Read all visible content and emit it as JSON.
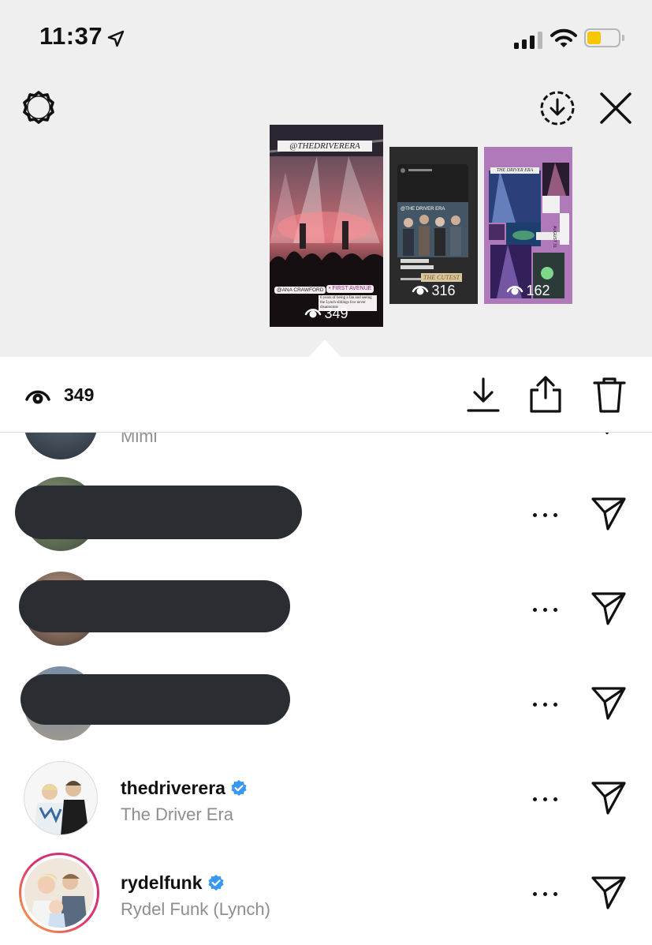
{
  "status_bar": {
    "time": "11:37",
    "battery_level": 0.45,
    "battery_color": "#f7c600"
  },
  "header": {
    "settings_icon": "gear-icon",
    "save_icon": "download-circle-icon",
    "close_icon": "close-icon"
  },
  "stories": [
    {
      "views": "349",
      "selected": true,
      "handle": "@THEDRIVERERA",
      "tags": [
        "@ANA CRAWFORD",
        "• FIRST AVENUE"
      ],
      "caption": "6 years of being a fan and seeing the Lynch siblings live never disappoints"
    },
    {
      "views": "316",
      "selected": false,
      "caption_top": "@THE DRIVER ERA",
      "tag_bottom": "THE CUTEST"
    },
    {
      "views": "162",
      "selected": false,
      "caption_top": "THE DRIVER ERA",
      "side_text": "AUGUST 31"
    }
  ],
  "action_bar": {
    "view_count": "349",
    "icons": [
      "eye-icon",
      "download-icon",
      "share-icon",
      "trash-icon"
    ]
  },
  "viewers": [
    {
      "username": "",
      "fullname": "Mimi",
      "redacted": false,
      "partial": true
    },
    {
      "username": "",
      "fullname": "",
      "redacted": true
    },
    {
      "username": "",
      "fullname": "",
      "redacted": true
    },
    {
      "username": "",
      "fullname": "",
      "redacted": true
    },
    {
      "username": "thedriverera",
      "fullname": "The Driver Era",
      "verified": true,
      "story_ring": false
    },
    {
      "username": "rydelfunk",
      "fullname": "Rydel Funk (Lynch)",
      "verified": true,
      "story_ring": true
    }
  ],
  "colors": {
    "verified_blue": "#3897f0",
    "redaction": "#2a2d31",
    "muted_text": "#8e8e8e"
  }
}
